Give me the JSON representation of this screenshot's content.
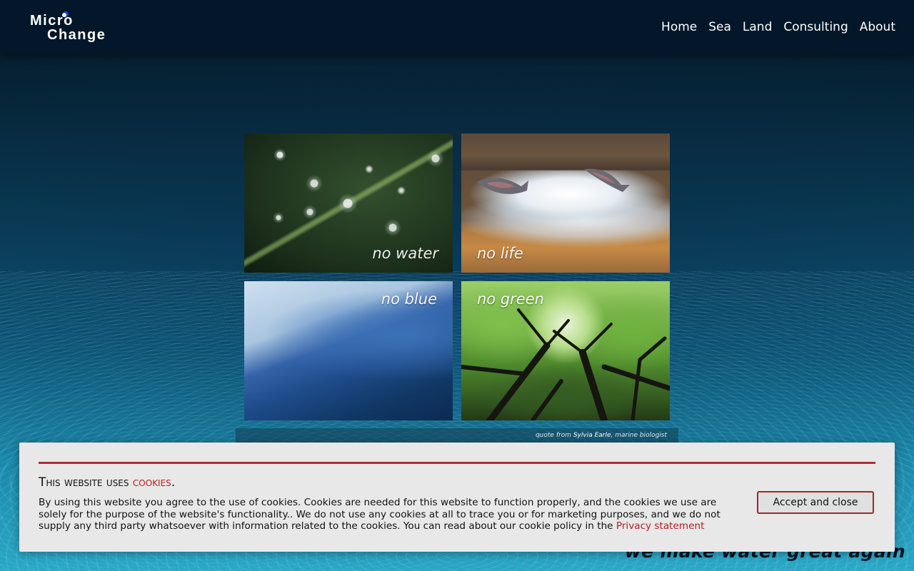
{
  "logo": {
    "line1": "Micro",
    "line2": "Change"
  },
  "nav": {
    "items": [
      "Home",
      "Sea",
      "Land",
      "Consulting",
      "About"
    ]
  },
  "tiles": [
    {
      "caption": "no water"
    },
    {
      "caption": "no life"
    },
    {
      "caption": "no blue"
    },
    {
      "caption": "no green"
    }
  ],
  "quote": {
    "prefix": "quote from",
    "author": "Sylvia Earle",
    "suffix": ", marine biologist"
  },
  "slogan": "we make water great again",
  "cookie": {
    "title_prefix": "This website uses",
    "title_link": "cookies",
    "title_suffix": ".",
    "body": "By using this website you agree to the use of cookies. Cookies are needed for this website to function properly, and the cookies we use are solely for the purpose of the website's functionality.. We do not use any cookies at all to trace you or for marketing purposes, and we do not supply any third party whatsoever with information related to the cookies. You can read about our cookie policy in the ",
    "privacy_link": "Privacy statement",
    "accept_label": "Accept and close",
    "accent_color": "#b02020"
  },
  "colors": {
    "header_bg": "#04172a",
    "nav_text": "#ffffff"
  }
}
